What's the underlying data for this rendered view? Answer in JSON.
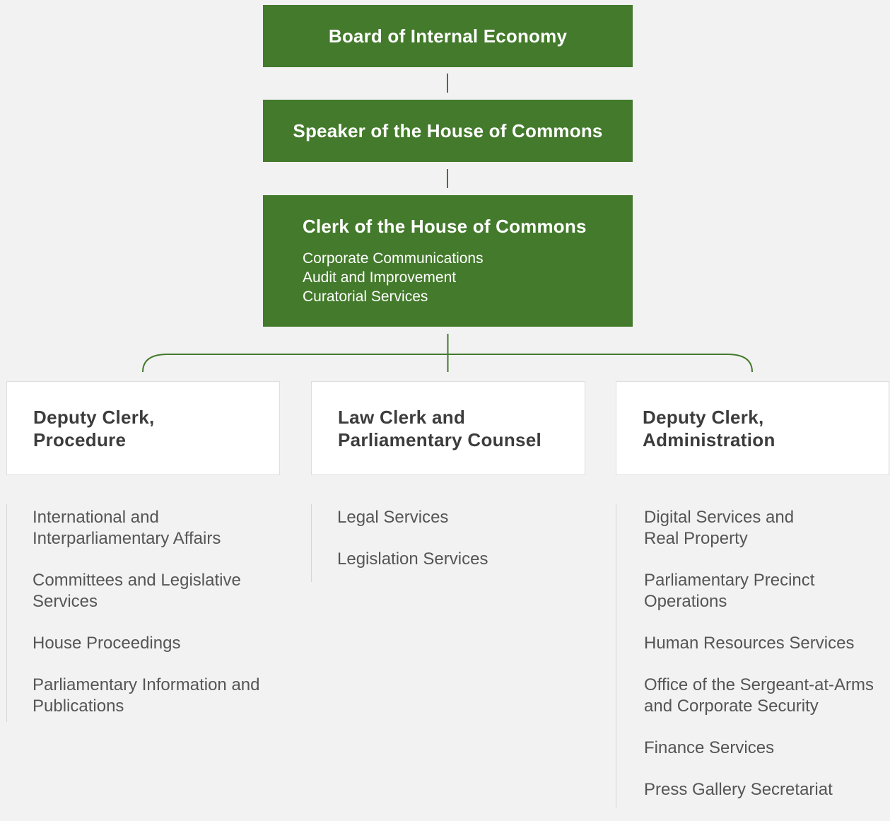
{
  "top": {
    "board": "Board of Internal Economy",
    "speaker": "Speaker of the House of Commons",
    "clerk": {
      "title": "Clerk of the House of Commons",
      "units": [
        "Corporate Communications",
        "Audit and Improvement",
        "Curatorial Services"
      ]
    }
  },
  "columns": [
    {
      "title": [
        "Deputy Clerk,",
        "Procedure"
      ],
      "items": [
        [
          "International and",
          "Interparliamentary Affairs"
        ],
        [
          "Committees and Legislative",
          "Services"
        ],
        [
          "House Proceedings"
        ],
        [
          "Parliamentary Information and",
          "Publications"
        ]
      ]
    },
    {
      "title": [
        "Law Clerk and",
        "Parliamentary Counsel"
      ],
      "items": [
        [
          "Legal Services"
        ],
        [
          "Legislation Services"
        ]
      ]
    },
    {
      "title": [
        "Deputy Clerk,",
        "Administration"
      ],
      "items": [
        [
          "Digital Services and",
          "Real Property"
        ],
        [
          "Parliamentary Precinct",
          "Operations"
        ],
        [
          "Human Resources Services"
        ],
        [
          "Office of the  Sergeant-at-Arms",
          "and Corporate Security"
        ],
        [
          "Finance Services"
        ],
        [
          "Press Gallery Secretariat"
        ]
      ]
    }
  ],
  "colors": {
    "green": "#437a2b",
    "background": "#f2f2f2",
    "text_dark": "#3c3c3c",
    "text_list": "#555555"
  }
}
